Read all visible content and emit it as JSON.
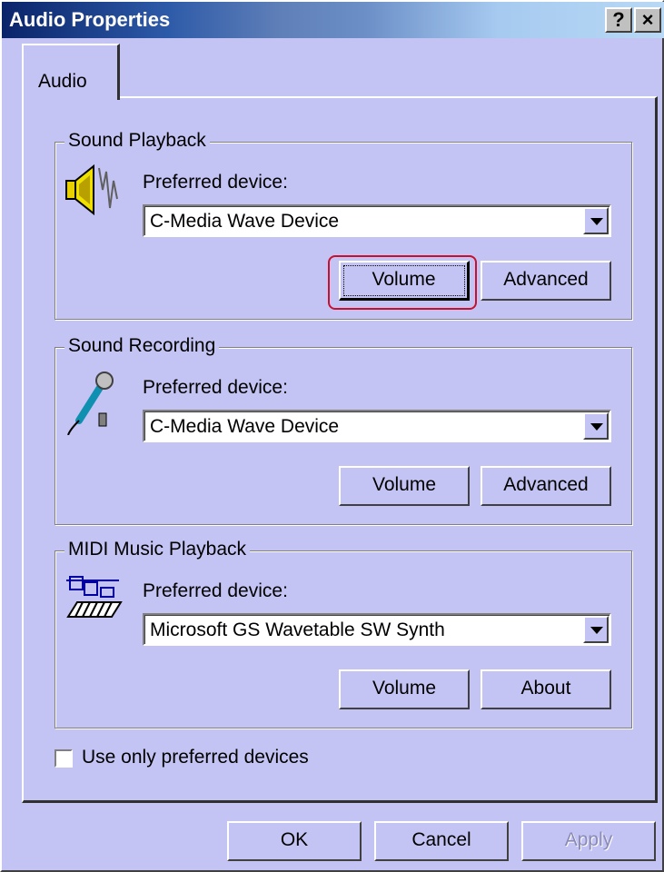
{
  "window": {
    "title": "Audio Properties",
    "help_label": "?",
    "close_label": "×"
  },
  "tabs": [
    {
      "label": "Audio"
    }
  ],
  "groups": {
    "playback": {
      "title": "Sound Playback",
      "preferred_label": "Preferred device:",
      "device": "C-Media Wave Device",
      "volume_label": "Volume",
      "advanced_label": "Advanced",
      "icon": "speaker-icon"
    },
    "recording": {
      "title": "Sound Recording",
      "preferred_label": "Preferred device:",
      "device": "C-Media Wave Device",
      "volume_label": "Volume",
      "advanced_label": "Advanced",
      "icon": "microphone-icon"
    },
    "midi": {
      "title": "MIDI Music Playback",
      "preferred_label": "Preferred device:",
      "device": "Microsoft GS Wavetable SW Synth",
      "volume_label": "Volume",
      "about_label": "About",
      "icon": "midi-keyboard-icon"
    }
  },
  "options": {
    "use_preferred_label": "Use only preferred devices",
    "use_preferred_checked": false
  },
  "footer": {
    "ok_label": "OK",
    "cancel_label": "Cancel",
    "apply_label": "Apply"
  },
  "colors": {
    "dialog_bg": "#c4c4f4",
    "highlight_ring": "#c8102e",
    "title_start": "#0a246a"
  }
}
